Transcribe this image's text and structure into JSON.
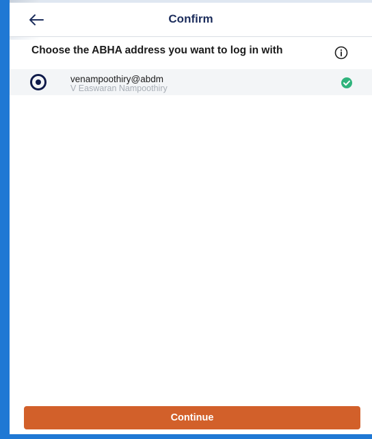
{
  "header": {
    "back_icon": "arrow-left-icon",
    "title": "Confirm"
  },
  "prompt": {
    "text": "Choose the ABHA address you want to log in with",
    "info_icon": "info-circle-icon"
  },
  "options": [
    {
      "address": "venampoothiry@abdm",
      "name": "V Easwaran Nampoothiry",
      "selected": true,
      "status_icon": "check-circle-icon",
      "status_color": "#2fb37c"
    }
  ],
  "footer": {
    "continue_label": "Continue"
  },
  "colors": {
    "accent": "#d2602a",
    "title": "#1c2d5c",
    "radio": "#0e1a4a",
    "frame": "#1f78d4"
  }
}
